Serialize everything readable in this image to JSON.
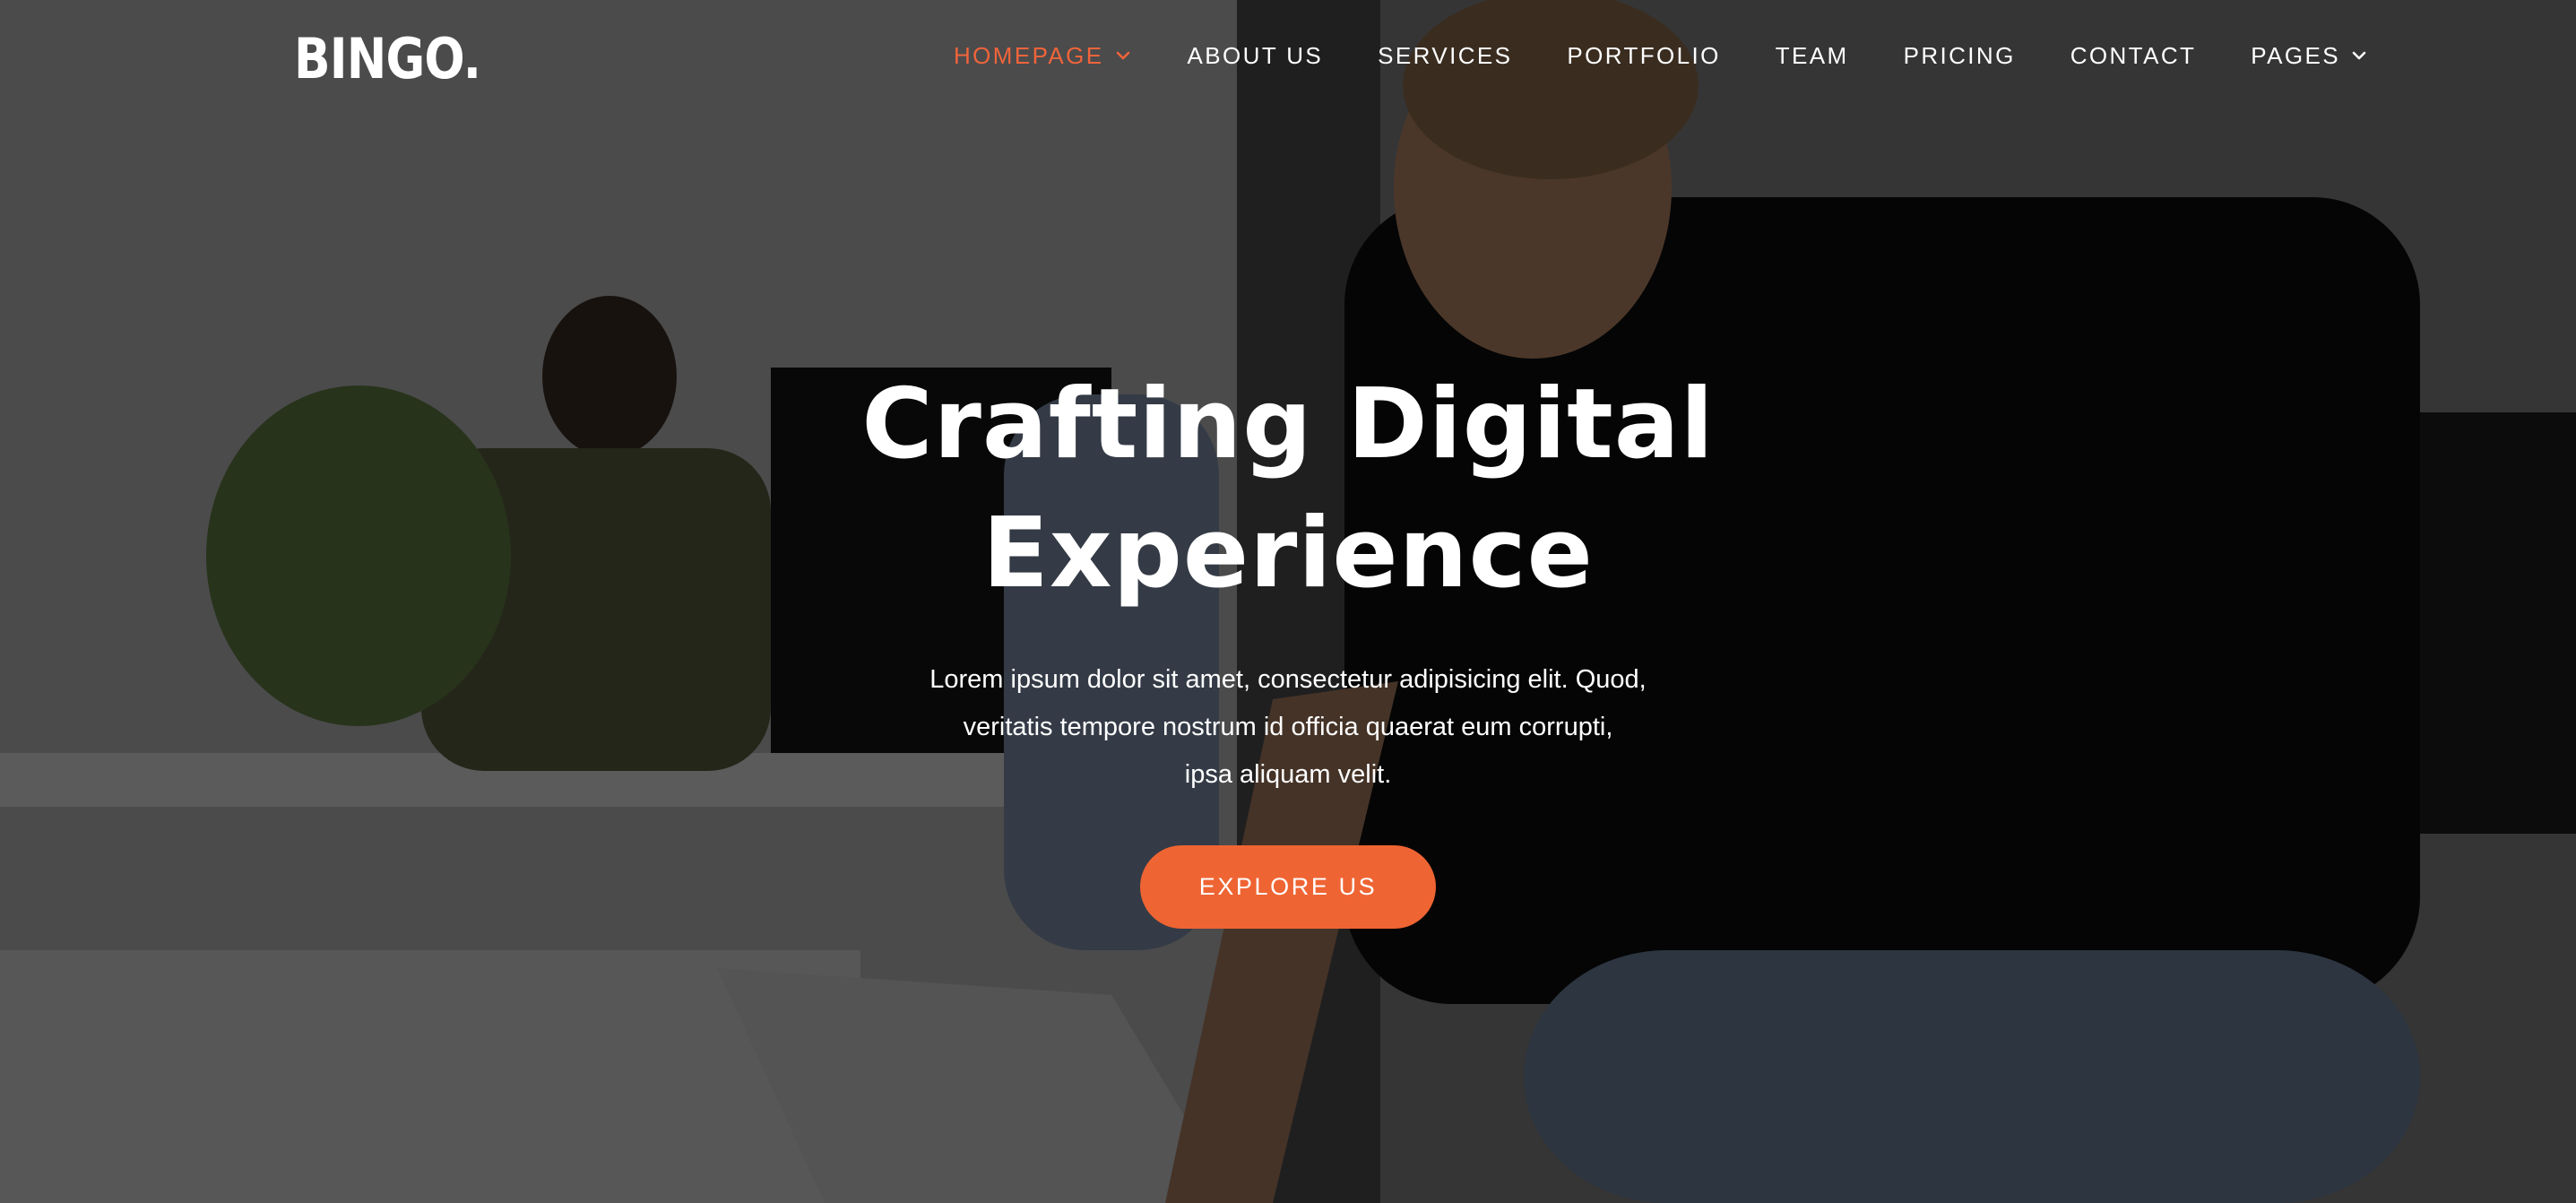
{
  "brand": {
    "logo": "BINGO.",
    "accent_color": "#ef6433"
  },
  "nav": {
    "items": [
      {
        "label": "HOMEPAGE",
        "active": true,
        "icon": "chevron-down-icon"
      },
      {
        "label": "ABOUT US"
      },
      {
        "label": "SERVICES"
      },
      {
        "label": "PORTFOLIO"
      },
      {
        "label": "TEAM"
      },
      {
        "label": "PRICING"
      },
      {
        "label": "CONTACT"
      },
      {
        "label": "PAGES",
        "icon": "chevron-down-icon"
      }
    ]
  },
  "hero": {
    "title_line1": "Crafting Digital",
    "title_line2": "Experience",
    "text_line1": "Lorem ipsum dolor sit amet, consectetur adipisicing elit. Quod,",
    "text_line2": "veritatis tempore nostrum id officia quaerat eum corrupti,",
    "text_line3": "ipsa aliquam velit.",
    "button_label": "EXPLORE US"
  }
}
